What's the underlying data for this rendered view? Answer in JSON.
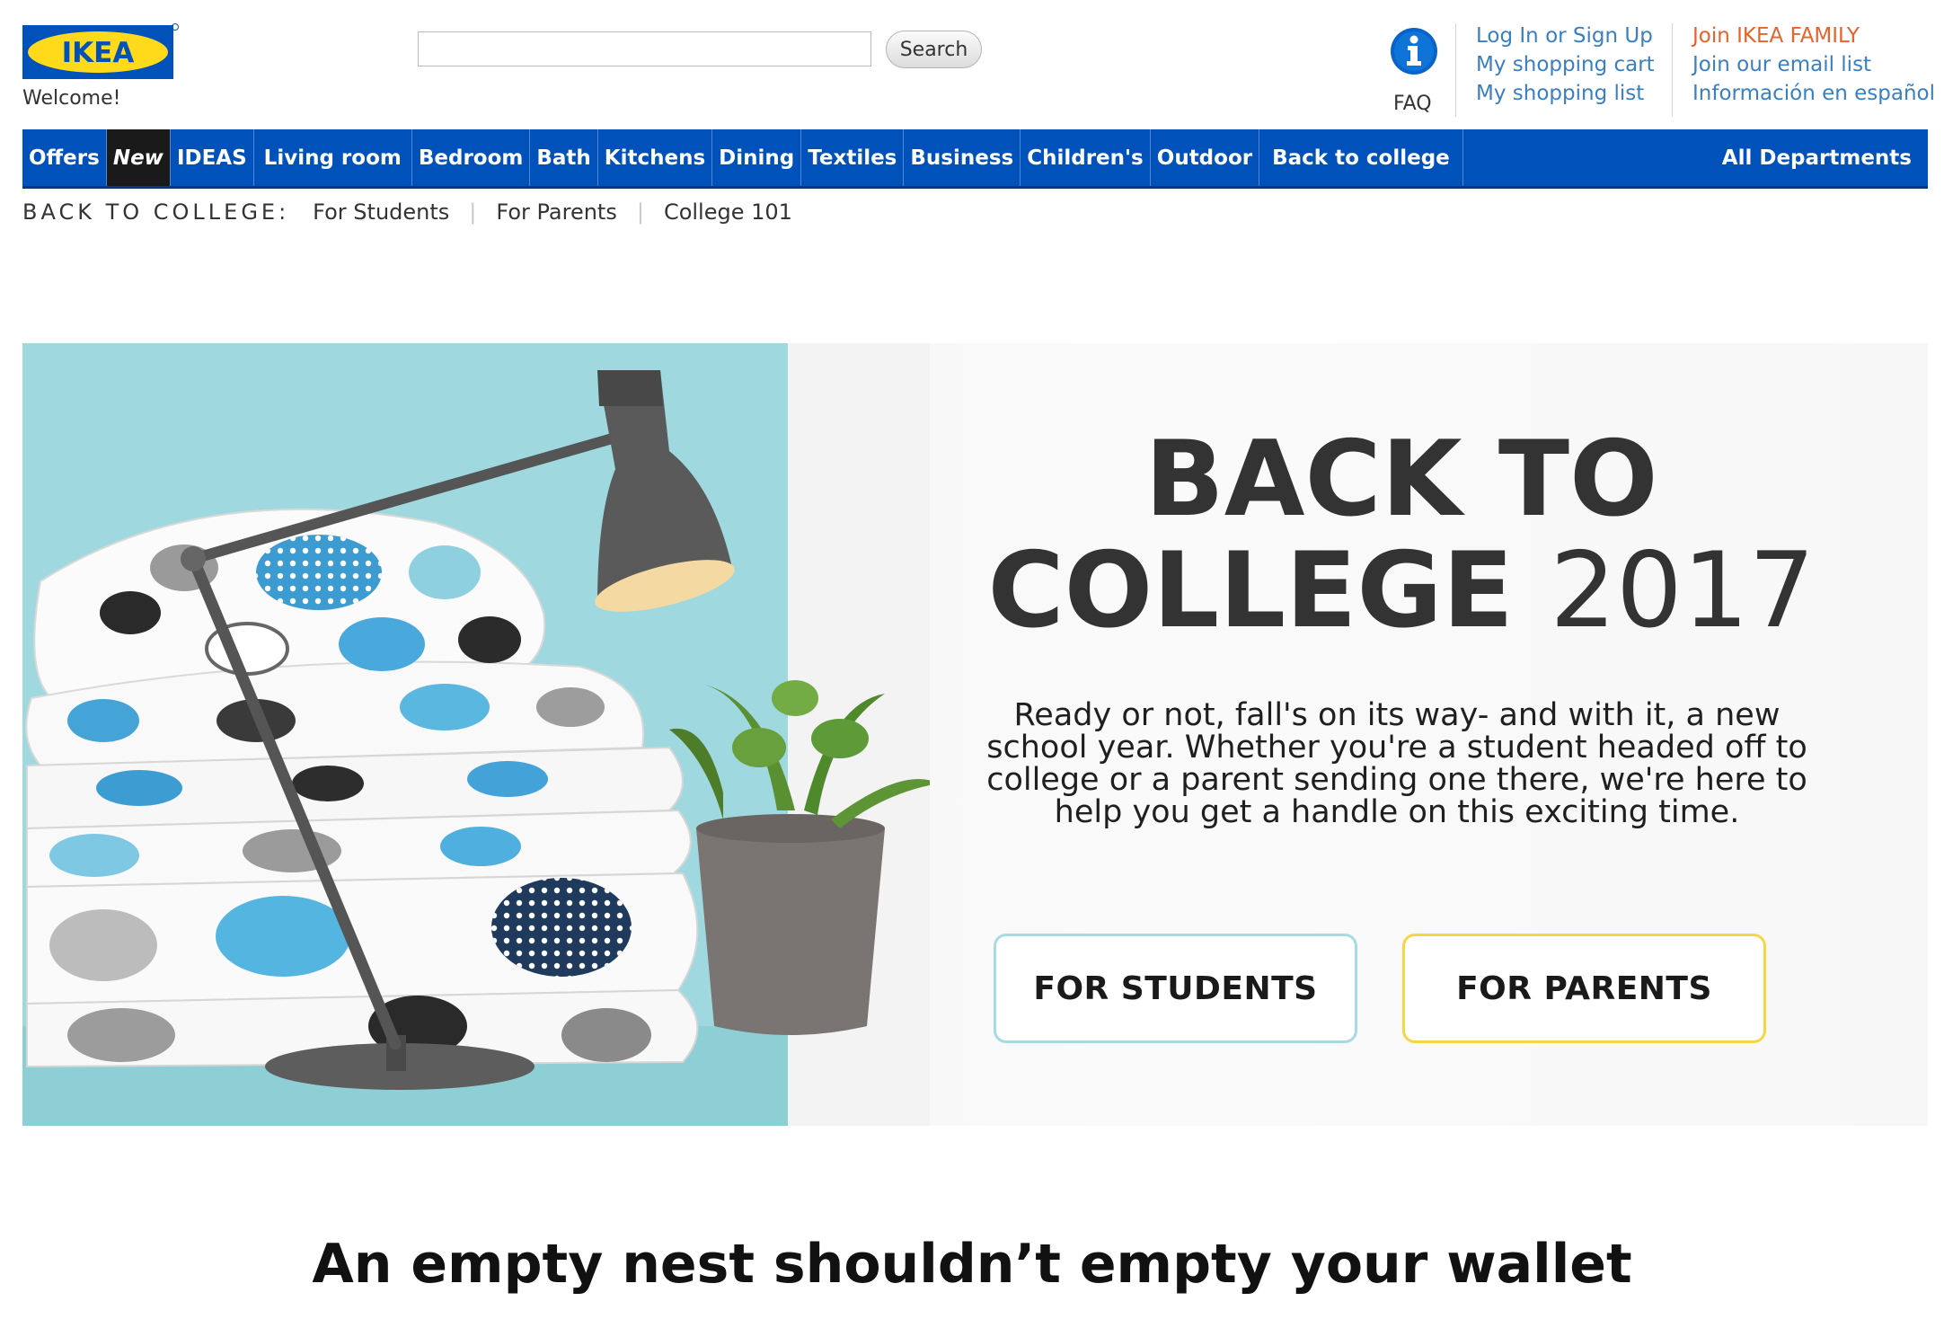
{
  "header": {
    "logo_text": "IKEA",
    "welcome": "Welcome!",
    "search": {
      "value": "",
      "placeholder": "",
      "button_label": "Search"
    },
    "faq_label": "FAQ",
    "account_links": [
      "Log In or Sign Up",
      "My shopping cart",
      "My shopping list"
    ],
    "family_links": [
      "Join IKEA FAMILY",
      "Join our email list",
      "Información en español"
    ]
  },
  "nav": {
    "items": [
      "Offers",
      "New",
      "IDEAS",
      "Living room",
      "Bedroom",
      "Bath",
      "Kitchens",
      "Dining",
      "Textiles",
      "Business",
      "Children's",
      "Outdoor",
      "Back to college"
    ],
    "all_departments": "All Departments"
  },
  "breadcrumb": {
    "title": "BACK TO COLLEGE:",
    "links": [
      "For Students",
      "For Parents",
      "College 101"
    ]
  },
  "hero": {
    "title_line1": "BACK TO",
    "title_line2_bold": "COLLEGE",
    "title_line2_year": "2017",
    "text": "Ready or not, fall's on its way- and with it, a new school year. Whether you're a student headed off to college or a parent sending one there, we're here to help you get a handle on this exciting time.",
    "button_students": "FOR STUDENTS",
    "button_parents": "FOR PARENTS"
  },
  "section": {
    "heading": "An empty nest shouldn’t empty your wallet"
  },
  "colors": {
    "brand_blue": "#0051ba",
    "brand_yellow": "#ffda1a",
    "link_blue": "#3a7fc1",
    "link_orange": "#e8622a",
    "hero_teal": "#9fd9df",
    "students_border": "#a7dbe2",
    "parents_border": "#f8d545"
  }
}
